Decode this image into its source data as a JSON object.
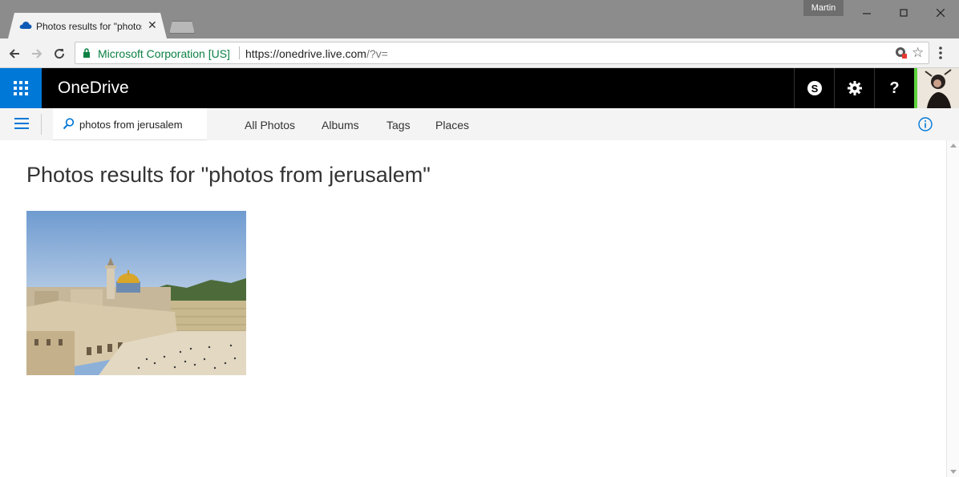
{
  "browser": {
    "tab_title": "Photos results for \"photos from jerusalem\"",
    "user_name": "Martin",
    "secure_label": "Microsoft Corporation [US]",
    "url_host": "https://onedrive.live.com",
    "url_rest": "/?v=",
    "icons": [
      "onedrive-cloud-icon",
      "close-icon",
      "back-icon",
      "forward-icon",
      "reload-icon",
      "lock-icon",
      "extension-icon",
      "star-icon",
      "menu-dots-icon"
    ]
  },
  "header": {
    "app_name": "OneDrive",
    "help_label": "?",
    "colors": {
      "waffle_bg": "#0078d7",
      "bar_bg": "#000000",
      "avatar_accent": "#5ed33f"
    }
  },
  "commandbar": {
    "search_value": "photos from jerusalem",
    "pivots": [
      "All Photos",
      "Albums",
      "Tags",
      "Places"
    ]
  },
  "main": {
    "title": "Photos results for \"photos from jerusalem\"",
    "results": [
      {
        "kind": "photo"
      }
    ]
  }
}
